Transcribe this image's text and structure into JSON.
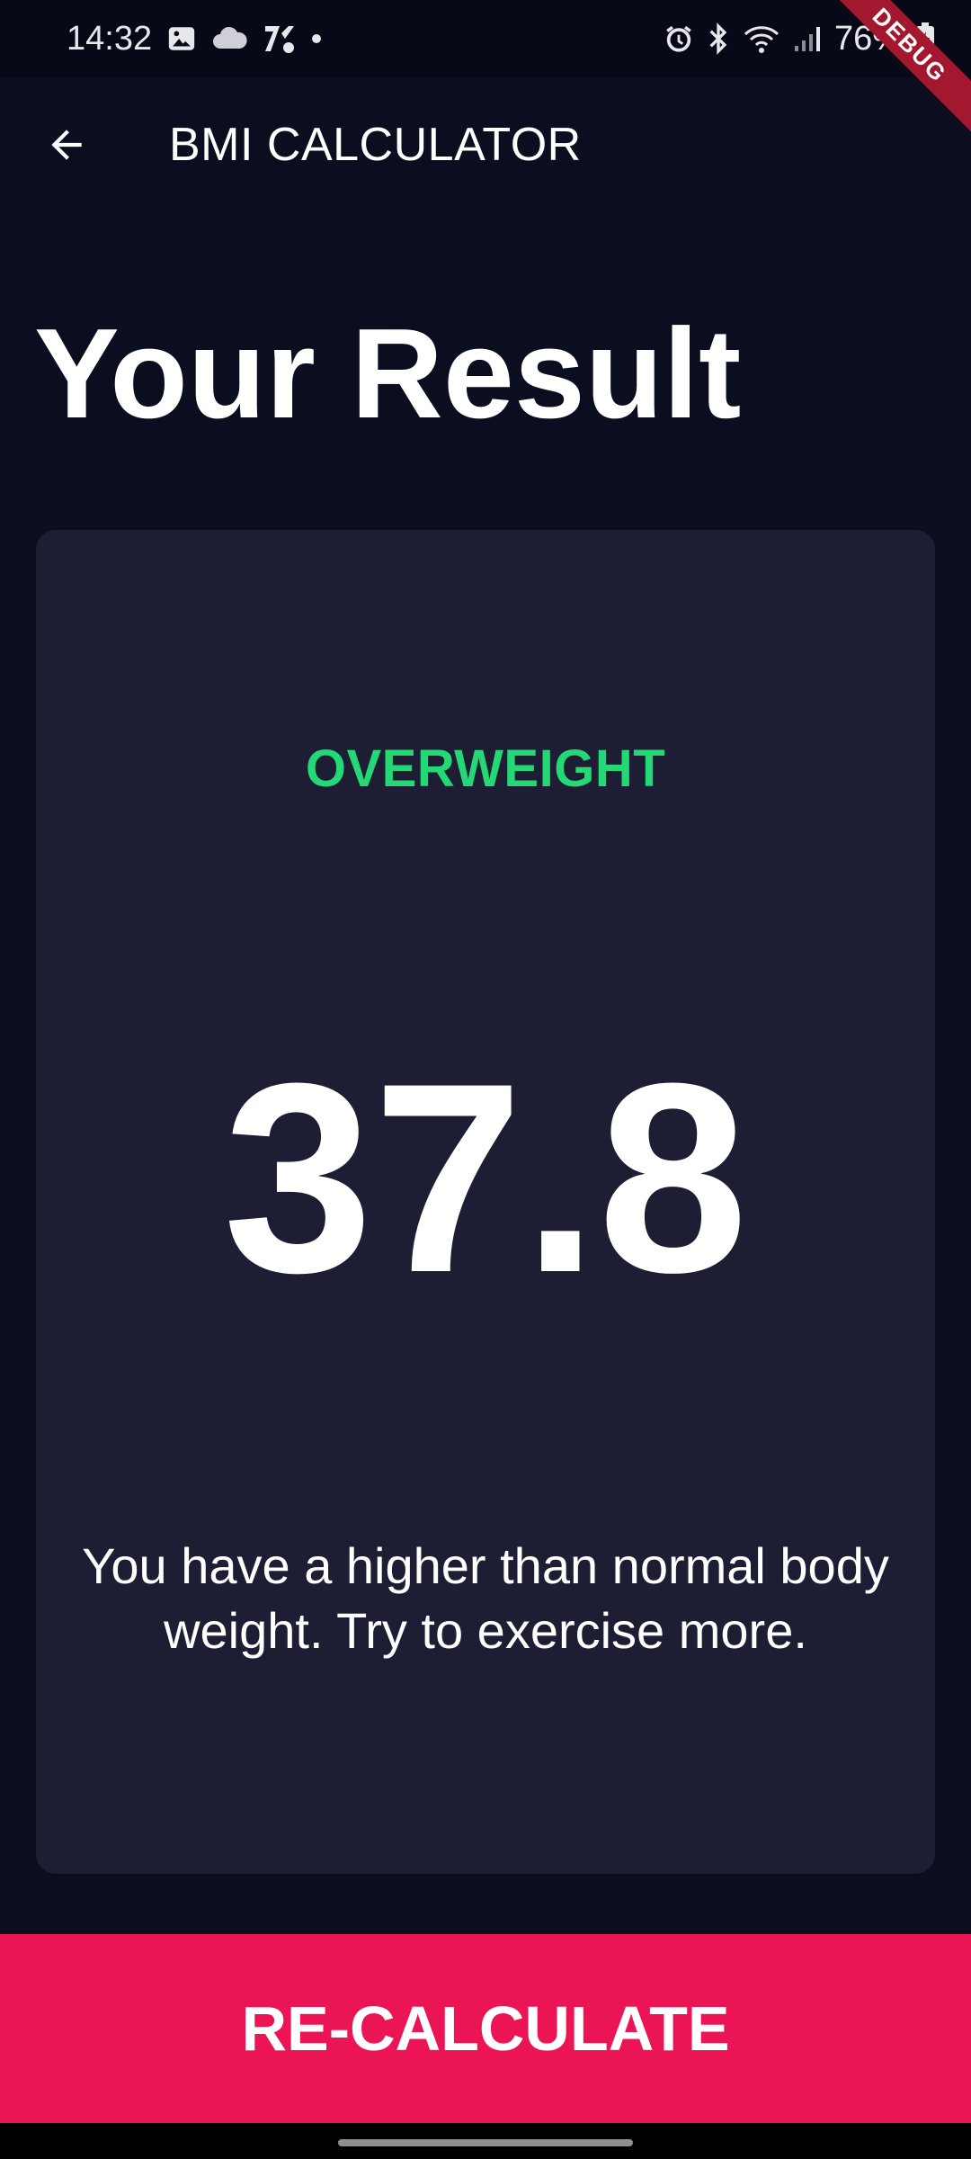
{
  "status_bar": {
    "time": "14:32",
    "battery_percent": "76%",
    "left_icons": [
      "gallery-icon",
      "cloud-icon",
      "app-icon",
      "notification-dot"
    ],
    "right_icons": [
      "alarm-icon",
      "bluetooth-icon",
      "wifi-icon",
      "signal-icon",
      "battery-icon"
    ]
  },
  "debug_banner": "DEBUG",
  "app_bar": {
    "title": "BMI CALCULATOR",
    "back_icon": "arrow-left-icon"
  },
  "page_title": "Your Result",
  "result": {
    "status": "OVERWEIGHT",
    "bmi_value": "37.8",
    "message": "You have a higher than normal body weight. Try to exercise more."
  },
  "recalculate_button": {
    "label": "RE-CALCULATE"
  },
  "colors": {
    "background": "#0a0e1f",
    "card": "#1d1e33",
    "status_green": "#24d876",
    "accent": "#eb1555",
    "debug_ribbon": "#a4182f"
  }
}
